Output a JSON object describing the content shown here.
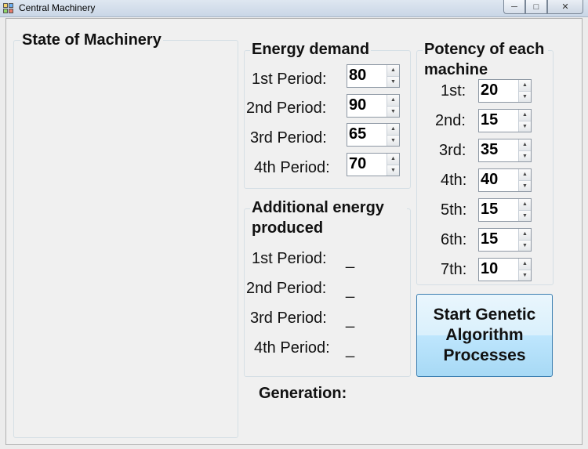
{
  "window": {
    "title": "Central Machinery"
  },
  "state_panel": {
    "title": "State of Machinery"
  },
  "energy_demand": {
    "title": "Energy demand",
    "rows": [
      {
        "label": "1st Period:",
        "value": "80"
      },
      {
        "label": "2nd Period:",
        "value": "90"
      },
      {
        "label": "3rd Period:",
        "value": "65"
      },
      {
        "label": "4th Period:",
        "value": "70"
      }
    ]
  },
  "additional_energy": {
    "title": "Additional energy produced",
    "rows": [
      {
        "label": "1st Period:",
        "value": "_"
      },
      {
        "label": "2nd Period:",
        "value": "_"
      },
      {
        "label": "3rd Period:",
        "value": "_"
      },
      {
        "label": "4th Period:",
        "value": "_"
      }
    ]
  },
  "potency": {
    "title": "Potency of each machine",
    "rows": [
      {
        "label": "1st:",
        "value": "20"
      },
      {
        "label": "2nd:",
        "value": "15"
      },
      {
        "label": "3rd:",
        "value": "35"
      },
      {
        "label": "4th:",
        "value": "40"
      },
      {
        "label": "5th:",
        "value": "15"
      },
      {
        "label": "6th:",
        "value": "15"
      },
      {
        "label": "7th:",
        "value": "10"
      }
    ]
  },
  "start_button": {
    "label": "Start Genetic Algorithm Processes"
  },
  "generation": {
    "label": "Generation:"
  },
  "icons": {
    "minimize": "minimize-icon",
    "maximize": "maximize-icon",
    "close": "close-icon",
    "up": "spin-up-icon",
    "down": "spin-down-icon"
  }
}
